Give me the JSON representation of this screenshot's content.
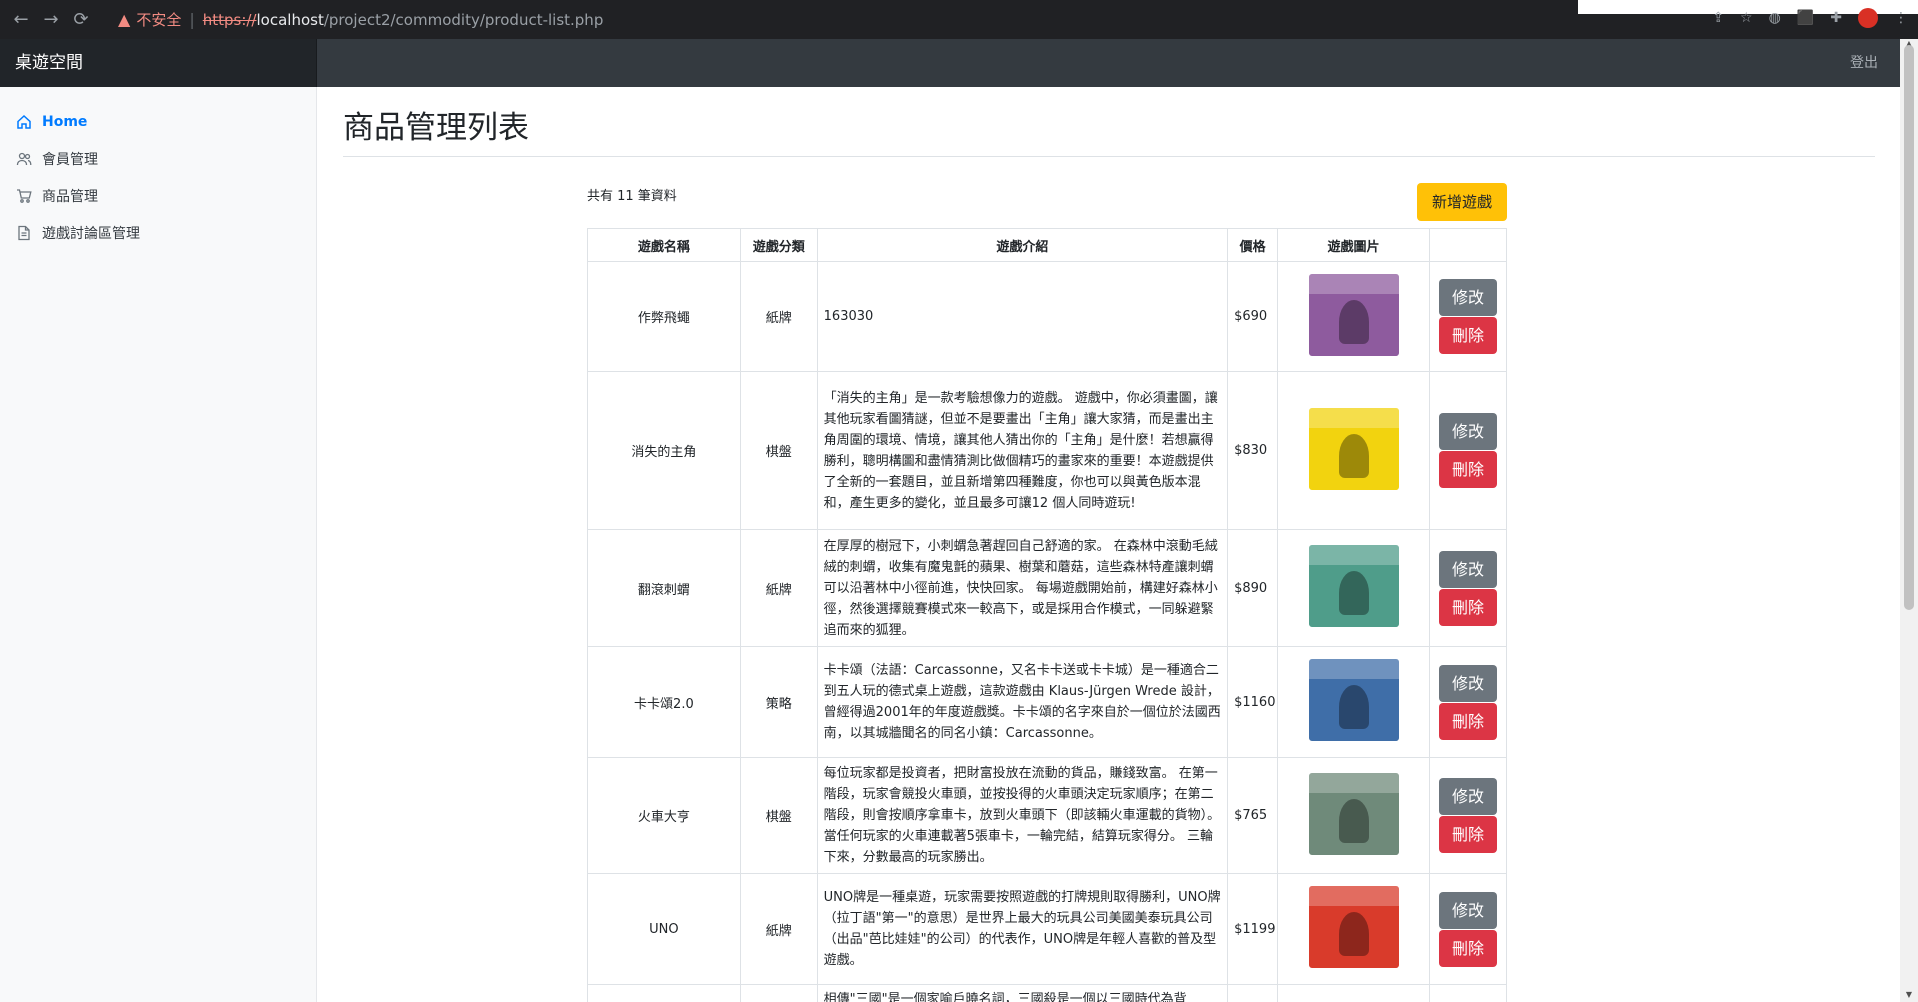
{
  "browser": {
    "insecure_label": "不安全",
    "url_scheme": "https://",
    "url_host": "localhost",
    "url_path": "/project2/commodity/product-list.php"
  },
  "navbar": {
    "brand": "桌遊空間",
    "signout": "登出"
  },
  "sidebar": {
    "items": [
      {
        "label": "Home",
        "icon": "home-icon",
        "active": true
      },
      {
        "label": "會員管理",
        "icon": "users-icon",
        "active": false
      },
      {
        "label": "商品管理",
        "icon": "cart-icon",
        "active": false
      },
      {
        "label": "遊戲討論區管理",
        "icon": "file-icon",
        "active": false
      }
    ]
  },
  "main": {
    "title": "商品管理列表",
    "count_text": "共有 11 筆資料",
    "add_button": "新增遊戲",
    "table": {
      "headers": [
        "遊戲名稱",
        "遊戲分類",
        "遊戲介紹",
        "價格",
        "遊戲圖片",
        ""
      ],
      "edit_label": "修改",
      "delete_label": "刪除",
      "rows": [
        {
          "name": "作弊飛蠅",
          "category": "紙牌",
          "desc": "163030",
          "price": "$690",
          "img_color": "#8e5b9e"
        },
        {
          "name": "消失的主角",
          "category": "棋盤",
          "desc": "「消失的主角」是一款考驗想像力的遊戲。 遊戲中，你必須畫圖，讓其他玩家看圖猜謎，但並不是要畫出「主角」讓大家猜，而是畫出主角周圍的環境、情境，讓其他人猜出你的「主角」是什麼！若想贏得勝利，聰明構圖和盡情猜測比做個精巧的畫家來的重要！本遊戲提供了全新的一套題目，並且新增第四種難度，你也可以與黃色版本混和，產生更多的變化，並且最多可讓12 個人同時遊玩!",
          "price": "$830",
          "img_color": "#f2d30f"
        },
        {
          "name": "翻滾刺蝟",
          "category": "紙牌",
          "desc": "在厚厚的樹冠下，小刺蝟急著趕回自己舒適的家。 在森林中滾動毛絨絨的刺蝟，收集有魔鬼氈的蘋果、樹葉和蘑菇，這些森林特產讓刺蝟可以沿著林中小徑前進，快快回家。 每場遊戲開始前，構建好森林小徑，然後選擇競賽模式來一較高下，或是採用合作模式，一同躲避緊追而來的狐狸。",
          "price": "$890",
          "img_color": "#4f9d8a"
        },
        {
          "name": "卡卡頌2.0",
          "category": "策略",
          "desc": "卡卡頌（法語：Carcassonne，又名卡卡送或卡卡城）是一種適合二到五人玩的德式桌上遊戲，這款遊戲由 Klaus-Jürgen Wrede 設計，曾經得過2001年的年度遊戲獎。卡卡頌的名字來自於一個位於法國西南，以其城牆聞名的同名小鎮：Carcassonne。",
          "price": "$1160",
          "img_color": "#3f6ea8"
        },
        {
          "name": "火車大亨",
          "category": "棋盤",
          "desc": "每位玩家都是投資者，把財富投放在流動的貨品，賺錢致富。 在第一階段，玩家會競投火車頭，並按投得的火車頭決定玩家順序；在第二階段，則會按順序拿車卡，放到火車頭下（即該輛火車運載的貨物）。 當任何玩家的火車連載著5張車卡，一輪完結，結算玩家得分。 三輪下來，分數最高的玩家勝出。",
          "price": "$765",
          "img_color": "#6f8a7a"
        },
        {
          "name": "UNO",
          "category": "紙牌",
          "desc": "UNO牌是一種桌遊，玩家需要按照遊戲的打牌規則取得勝利，UNO牌（拉丁語\"第一\"的意思）是世界上最大的玩具公司美國美泰玩具公司（出品\"芭比娃娃\"的公司）的代表作，UNO牌是年輕人喜歡的普及型遊戲。",
          "price": "$1199",
          "img_color": "#d93b2b"
        },
        {
          "name": "",
          "category": "",
          "desc": "相傳\"三國\"是一個家喻戶曉名詞，三國殺是一個以三國時代為背",
          "price": "",
          "img_color": "#444444"
        }
      ]
    }
  },
  "colors": {
    "primary": "#007bff",
    "warning": "#ffc107",
    "secondary": "#6c757d",
    "danger": "#dc3545",
    "navbar": "#343a40"
  }
}
